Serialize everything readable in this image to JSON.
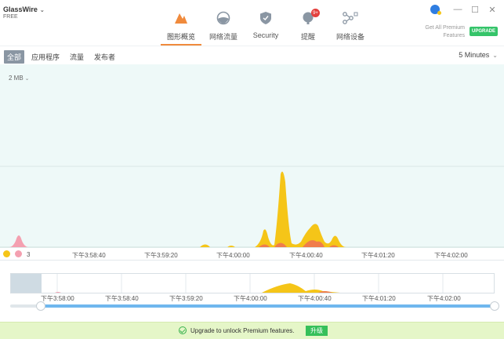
{
  "app": {
    "name": "GlassWire",
    "plan": "FREE"
  },
  "nav": {
    "tabs": [
      {
        "label": "图形概览",
        "icon": "graph-icon",
        "active": true
      },
      {
        "label": "网络流量",
        "icon": "globe-icon"
      },
      {
        "label": "Security",
        "icon": "shield-icon"
      },
      {
        "label": "提醒",
        "icon": "alert-bell-icon",
        "badge": "9+"
      },
      {
        "label": "网络设备",
        "icon": "network-devices-icon"
      }
    ]
  },
  "premium": {
    "line1": "Get All Premium",
    "line2": "Features",
    "upgrade_label": "UPGRADE"
  },
  "filters": {
    "items": [
      "全部",
      "应用程序",
      "流量",
      "发布者"
    ],
    "active_index": 0,
    "time_range": "5 Minutes"
  },
  "graph": {
    "scale_label": "2 MB",
    "axis_left_label": "3",
    "x_ticks": [
      "下午3:58:40",
      "下午3:59:20",
      "下午4:00:00",
      "下午4:00:40",
      "下午4:01:20",
      "下午4:02:00"
    ]
  },
  "overview": {
    "x_ticks": [
      "下午3:58:00",
      "下午3:58:40",
      "下午3:59:20",
      "下午4:00:00",
      "下午4:00:40",
      "下午4:01:20",
      "下午4:02:00"
    ]
  },
  "banner": {
    "message": "Upgrade to unlock Premium features.",
    "button": "升级"
  },
  "colors": {
    "accent": "#f08a3c",
    "incoming": "#f5c518",
    "outgoing": "#f07d4b",
    "graph_bg": "#eef9f8",
    "upgrade": "#35c46a"
  }
}
